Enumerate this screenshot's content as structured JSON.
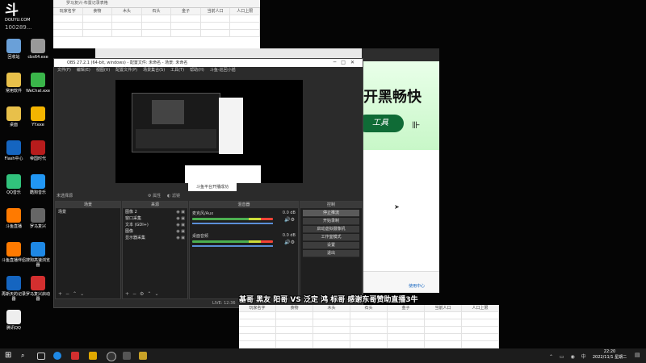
{
  "logo": {
    "brand": "斗鱼",
    "sub": "DOUYU.COM",
    "room": "100289..."
  },
  "desktop_icons": [
    {
      "label": "回收站",
      "color": "#6aa0d8"
    },
    {
      "label": "cbs64.exe",
      "color": "#999999"
    },
    {
      "label": "常用软件",
      "color": "#e8c04a"
    },
    {
      "label": "WeChat.exe",
      "color": "#3ab54a"
    },
    {
      "label": "桌面",
      "color": "#e8c04a"
    },
    {
      "label": "YY.exe",
      "color": "#f4b400"
    },
    {
      "label": "Flash中心",
      "color": "#1565c0"
    },
    {
      "label": "帝国时代",
      "color": "#b71c1c"
    },
    {
      "label": "QQ音乐",
      "color": "#31c27c"
    },
    {
      "label": "酷狗音乐",
      "color": "#2196f3"
    },
    {
      "label": "斗鱼直播",
      "color": "#ff7a00"
    },
    {
      "label": "罗马复兴",
      "color": "#666666"
    },
    {
      "label": "斗鱼直播伴侣",
      "color": "#ff7a00"
    },
    {
      "label": "搜狗高速浏览器",
      "color": "#1e88e5"
    },
    {
      "label": "再斯天的记录器",
      "color": "#1565c0"
    },
    {
      "label": "罗马复兴启动器",
      "color": "#d32f2f"
    },
    {
      "label": "腾讯QQ",
      "color": "#eeeeee"
    }
  ],
  "sheet_top": {
    "title": "罗马复兴-布置记录表格",
    "headers": [
      "玩家名字",
      "食物",
      "木头",
      "石头",
      "金子",
      "当前人口",
      "人口上限"
    ]
  },
  "obs": {
    "title": "OBS 27.2.1 (64-bit, windows) - 配置文件: 未命名 - 场景: 未命名",
    "menu": [
      "文件(F)",
      "编辑(E)",
      "视图(V)",
      "配置文件(P)",
      "场景集合(S)",
      "工具(T)",
      "帮助(H)",
      "斗鱼-巡回小插"
    ],
    "toast": "斗鱼平台开播成功",
    "source_label": "未选择源",
    "props_btn": "属性",
    "filters_btn": "滤镜",
    "panels": {
      "scenes": "场景",
      "sources": "来源",
      "mixer": "混音器",
      "controls": "控制"
    },
    "scenes": [
      "场景"
    ],
    "sources": [
      "图像 2",
      "窗口采集",
      "文本 (GDI+)",
      "图像",
      "显示器采集"
    ],
    "mixer": [
      {
        "name": "麦克风/Aux",
        "db": "0.0 dB"
      },
      {
        "name": "桌面音频",
        "db": "0.0 dB"
      }
    ],
    "controls": [
      "停止推流",
      "开始录制",
      "启动虚拟摄像机",
      "工作室模式",
      "设置",
      "退出"
    ],
    "status": "LIVE: 12:36"
  },
  "web": {
    "banner_text": "开黑畅快",
    "sub_text": "工具",
    "footer_link": "使用中心"
  },
  "subtitle": "基哥 黑友 阳哥 VS 泛定 鸿 标哥 感谢东哥赞助直播3牛",
  "sheet_bottom": {
    "headers": [
      "玩家名字",
      "食物",
      "木头",
      "石头",
      "金子",
      "当前人口",
      "人口上限"
    ]
  },
  "taskbar": {
    "time": "22:20",
    "date": "2022/11/1 星期二"
  }
}
